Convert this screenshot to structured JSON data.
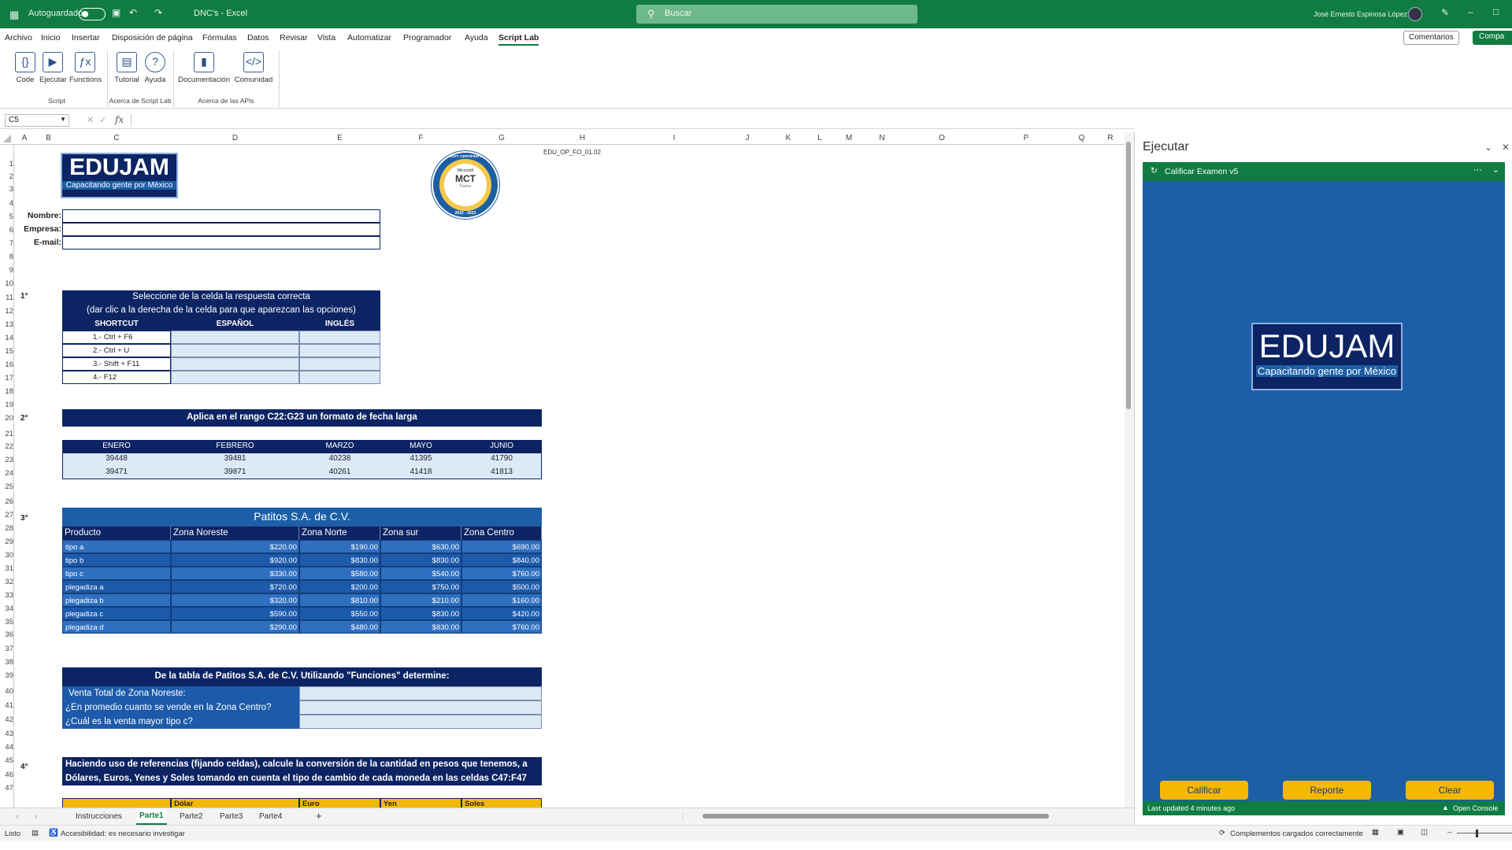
{
  "titlebar": {
    "autosave_label": "Autoguardado",
    "doc_title": "DNC's  -  Excel",
    "search_placeholder": "Buscar",
    "user_name": "José Ernesto Espinosa López"
  },
  "menu": {
    "items": [
      "Archivo",
      "Inicio",
      "Insertar",
      "Disposición de página",
      "Fórmulas",
      "Datos",
      "Revisar",
      "Vista",
      "Automatizar",
      "Programador",
      "Ayuda",
      "Script Lab"
    ],
    "comments_label": "Comentarios",
    "share_label": "Compa"
  },
  "ribbon": {
    "buttons": [
      {
        "label": "Code",
        "icon": "code-icon"
      },
      {
        "label": "Ejecutar",
        "icon": "run-icon"
      },
      {
        "label": "Functions",
        "icon": "functions-icon"
      },
      {
        "label": "Tutorial",
        "icon": "book-icon"
      },
      {
        "label": "Ayuda",
        "icon": "help-icon"
      },
      {
        "label": "Documentación",
        "icon": "document-icon"
      },
      {
        "label": "Comunidad",
        "icon": "community-icon"
      }
    ],
    "groups": [
      "Script",
      "Acerca de Script Lab",
      "Acerca de las APIs"
    ]
  },
  "formula_bar": {
    "name_box": "C5",
    "fx": "fx"
  },
  "columns": [
    "A",
    "B",
    "C",
    "D",
    "E",
    "F",
    "G",
    "H",
    "I",
    "J",
    "K",
    "L",
    "M",
    "N",
    "O",
    "P",
    "Q",
    "R"
  ],
  "sheet": {
    "logo_title": "EDUJAM",
    "logo_subtitle": "Capacitando gente por México",
    "badge_top": "MICROSOFT CERTIFIED TRAINER",
    "badge_ms": "Microsoft",
    "badge_mct": "MCT",
    "badge_trainer": "Trainer",
    "badge_years": "2022 - 2023",
    "doc_code": "EDU_OP_FO_01.02",
    "labels": {
      "nombre": "Nombre:",
      "empresa": "Empresa:",
      "email": "E-mail:"
    },
    "q1": {
      "num": "1°",
      "title1": "Seleccione de la celda la respuesta correcta",
      "title2": "(dar clic a la derecha de la celda para que aparezcan las opciones)",
      "headers": [
        "SHORTCUT",
        "ESPAÑOL",
        "INGLÉS"
      ],
      "rows": [
        "1.-   Ctrl + F6",
        "2.-   Ctrl + U",
        "3.-   Shift + F11",
        "4.-   F12"
      ]
    },
    "q2": {
      "num": "2°",
      "title": "Aplica en el rango C22:G23 un formato de fecha larga",
      "headers": [
        "ENERO",
        "FEBRERO",
        "MARZO",
        "MAYO",
        "JUNIO"
      ],
      "rows": [
        [
          "39448",
          "39481",
          "40238",
          "41395",
          "41790"
        ],
        [
          "39471",
          "39871",
          "40261",
          "41418",
          "41813"
        ]
      ]
    },
    "q3": {
      "num": "3°",
      "title": "Patitos S.A. de C.V.",
      "headers": [
        "Producto",
        "Zona Noreste",
        "Zona Norte",
        "Zona sur",
        "Zona Centro"
      ],
      "rows": [
        [
          "tipo a",
          "$220.00",
          "$190.00",
          "$630.00",
          "$690.00"
        ],
        [
          "tipo b",
          "$920.00",
          "$830.00",
          "$830.00",
          "$840.00"
        ],
        [
          "tipo c",
          "$330.00",
          "$580.00",
          "$540.00",
          "$760.00"
        ],
        [
          "plegadiza a",
          "$720.00",
          "$200.00",
          "$750.00",
          "$500.00"
        ],
        [
          "plegadiza b",
          "$320.00",
          "$810.00",
          "$210.00",
          "$160.00"
        ],
        [
          "plegadiza c",
          "$590.00",
          "$550.00",
          "$830.00",
          "$420.00"
        ],
        [
          "plegadiza d",
          "$290.00",
          "$480.00",
          "$830.00",
          "$760.00"
        ]
      ]
    },
    "funciones": {
      "title": "De la tabla de Patitos S.A. de C.V.     Utilizando \"Funciones\" determine:",
      "questions": [
        "Venta Total de Zona Noreste:",
        "¿En promedio cuanto se vende en la Zona Centro?",
        "¿Cuál es la venta mayor tipo c?"
      ]
    },
    "q4": {
      "num": "4°",
      "line1": "Haciendo uso de referencias (fijando celdas), calcule la conversión de la cantidad en pesos que tenemos, a",
      "line2": "Dólares, Euros, Yenes y Soles tomando en cuenta el tipo de cambio de cada moneda en las celdas C47:F47",
      "headers": [
        "",
        "Dólar",
        "Euro",
        "Yen",
        "Soles"
      ]
    }
  },
  "tabs": [
    "Instrucciones",
    "Parte1",
    "Parte2",
    "Parte3",
    "Parte4"
  ],
  "status": {
    "ready": "Listo",
    "accessibility": "Accesibilidad: es necesario investigar",
    "addins": "Complementos cargados correctamente"
  },
  "pane": {
    "title": "Ejecutar",
    "script_name": "Calificar Examen v5",
    "buttons": [
      "Calificar",
      "Reporte",
      "Clear"
    ],
    "last_updated": "Last updated 4 minutes ago",
    "open_console": "Open Console"
  }
}
